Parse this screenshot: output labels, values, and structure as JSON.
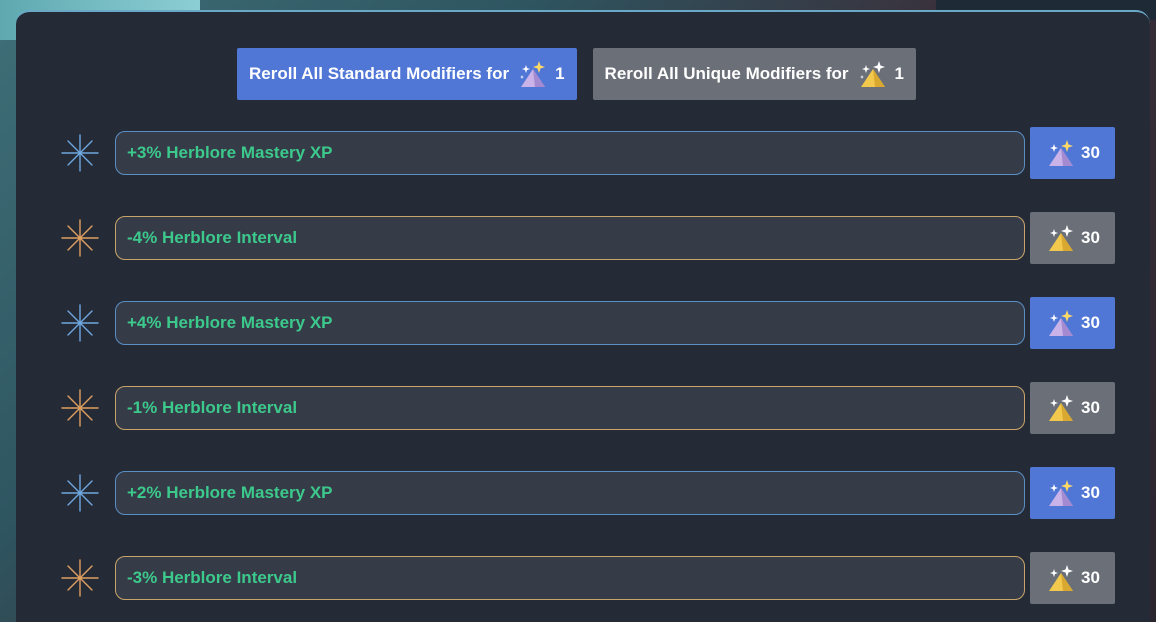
{
  "top_buttons": {
    "standard": {
      "label": "Reroll All Standard Modifiers for",
      "cost": "1",
      "icon": "ancient-shard-icon"
    },
    "unique": {
      "label": "Reroll All Unique Modifiers for",
      "cost": "1",
      "icon": "ancient-shard-icon"
    }
  },
  "modifiers": [
    {
      "text": "+3% Herblore Mastery XP",
      "type": "standard",
      "cost": "30"
    },
    {
      "text": "-4% Herblore Interval",
      "type": "unique",
      "cost": "30"
    },
    {
      "text": "+4% Herblore Mastery XP",
      "type": "standard",
      "cost": "30"
    },
    {
      "text": "-1% Herblore Interval",
      "type": "unique",
      "cost": "30"
    },
    {
      "text": "+2% Herblore Mastery XP",
      "type": "standard",
      "cost": "30"
    },
    {
      "text": "-3% Herblore Interval",
      "type": "unique",
      "cost": "30"
    }
  ],
  "colors": {
    "standard_accent": "#5177d6",
    "unique_accent": "#6b7078",
    "modifier_text": "#3cc98c",
    "standard_star": "#6ea8e0",
    "unique_star": "#e0a060"
  }
}
